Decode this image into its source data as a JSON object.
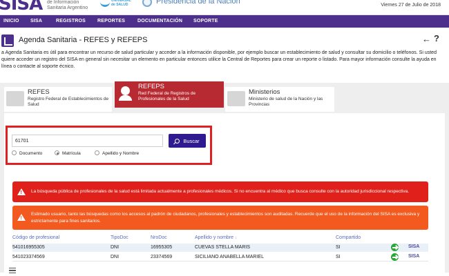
{
  "header": {
    "logo_text": "SISA",
    "logo_subtitle": [
      "de Información",
      "Sanitaria Argentino"
    ],
    "universal_salud": "UNIVERSAL de SALUD",
    "presidencia": "Presidencia de la Nación",
    "date": "Viernes 27 de Julio de 2018"
  },
  "nav": {
    "items": [
      "INICIO",
      "SISA",
      "REGISTROS",
      "REPORTES",
      "DOCUMENTACIÓN",
      "SOPORTE"
    ]
  },
  "page": {
    "title": "Agenda Sanitaria - REFES y REFEPS",
    "back_icon": "←",
    "help_icon": "?",
    "intro": "a Agenda Sanitaria es útil para encontrar un recurso de salud particular y acceder a la información disponible, por ejemplo buscar un establecimiento de salud y consultar su domicilio o teléfonos. Si usted quiere acceder un registro del SISA en general sin necesitar un elemento en particular entonces utilice la Central de Reportes para crear un reporte o listado. Para mayor información consulte la ayuda en línea o contacte al soporte écnico."
  },
  "tabs": [
    {
      "title": "REFES",
      "subtitle": "Registro Federal de Establecimientos de Salud",
      "icon": "hospital-icon",
      "active": false
    },
    {
      "title": "REFEPS",
      "subtitle": "Red Federal de Registros de Profesionales de la Salud",
      "icon": "doctor-icon",
      "active": true
    },
    {
      "title": "Ministerios",
      "subtitle": "Ministerio de salud de la Nación y las Provincias",
      "icon": "building-icon",
      "active": false
    }
  ],
  "search": {
    "value": "61701",
    "button_label": "Buscar",
    "options": [
      "Documento",
      "Matrícula",
      "Apellido y Nombre"
    ],
    "selected": "Matrícula"
  },
  "alerts": [
    {
      "type": "danger",
      "color": "#e0201a",
      "text": "La búsqueda pública de profesionales de la salud está limitada actualmente a profesionales médicos. Si no encuentra al médico que busca consulte con la autoridad jurisdiccional respectiva."
    },
    {
      "type": "warning",
      "color": "#f25a1f",
      "text": "Estimado usuario, tanto las búsquedas como los accesos al padrón de ciudadanos, profesionales y establecimientos son auditadas. Recuerde que el uso de la información del SISA es exclusiva y estrictamente para fines sanitarios."
    }
  ],
  "table": {
    "headers": [
      "Código de profesional",
      "TipoDoc",
      "NroDoc",
      "Apellido y nombre",
      "Compartido"
    ],
    "rows": [
      {
        "codigo": "541016955305",
        "tipo": "DNI",
        "nro": "16955305",
        "nombre": "CUEVAS STELLA MARIS",
        "compartido": "SI"
      },
      {
        "codigo": "541023374569",
        "tipo": "DNI",
        "nro": "23374569",
        "nombre": "SICILIANO ANABELLA MARIEL",
        "compartido": "SI"
      }
    ],
    "row_logo": "SISA"
  },
  "colors": {
    "brand": "#4d2f8c",
    "active_tab": "#b82a31",
    "search_button": "#2f1b8f",
    "highlight_border": "#e02020"
  }
}
